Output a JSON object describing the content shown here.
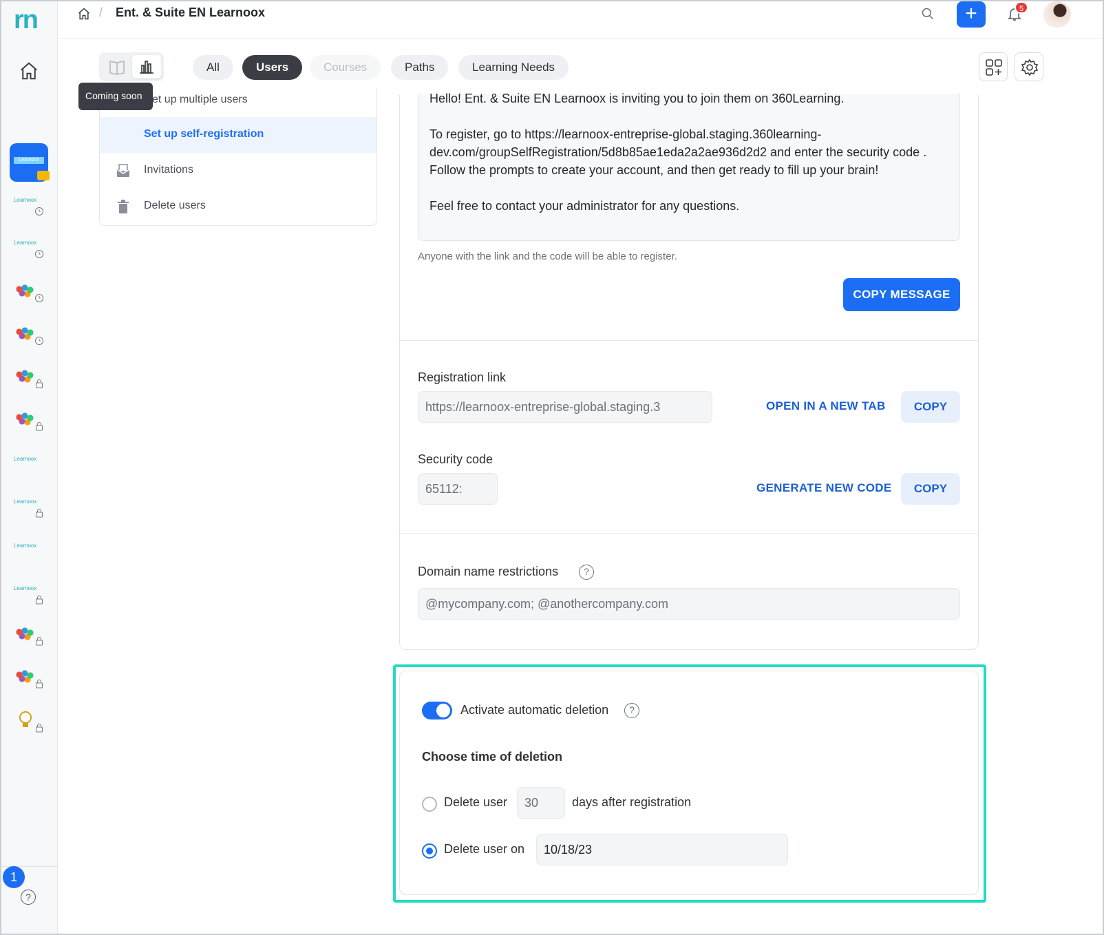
{
  "rail": {
    "logo": "rn",
    "active_mini": "Learnoox",
    "items": [
      {
        "label": "Learnoox"
      },
      {
        "label": "Learnoox"
      },
      {
        "label": "Learnoox"
      },
      {
        "label": "Learnoox"
      },
      {
        "label": "Learnoox"
      },
      {
        "label": "Learnoox"
      }
    ],
    "notification_count": "1",
    "help": "?"
  },
  "topbar": {
    "breadcrumb_separator": "/",
    "title": "Ent. & Suite EN Learnoox",
    "add_label": "+",
    "notifications_badge": "5"
  },
  "toolbar": {
    "tooltip": "Coming soon",
    "chips": [
      "All",
      "Users",
      "Courses",
      "Paths",
      "Learning Needs"
    ]
  },
  "submenu": {
    "items": [
      {
        "label": "Set up multiple users",
        "visible_label": "et up multiple users"
      },
      {
        "label": "Set up self-registration"
      },
      {
        "label": "Invitations"
      },
      {
        "label": "Delete users"
      }
    ]
  },
  "message": {
    "line1": "Hello! Ent. & Suite EN Learnoox is inviting you to join them on 360Learning.",
    "line2": "To register, go to https://learnoox-entreprise-global.staging.360learning-dev.com/groupSelfRegistration/5d8b85ae1eda2a2ae936d2d2 and enter the security code . Follow the prompts to create your account, and then get ready to fill up your brain!",
    "line3": "Feel free to contact your administrator for any questions.",
    "hint": "Anyone with the link and the code will be able to register.",
    "copy_button": "COPY MESSAGE"
  },
  "registration": {
    "label": "Registration link",
    "value": "https://learnoox-entreprise-global.staging.3",
    "open_tab": "OPEN IN A NEW TAB",
    "copy": "COPY"
  },
  "security": {
    "label": "Security code",
    "value": "65112:",
    "generate": "GENERATE NEW CODE",
    "copy": "COPY"
  },
  "domain": {
    "label": "Domain name restrictions",
    "placeholder": "@mycompany.com; @anothercompany.com"
  },
  "deletion": {
    "toggle_label": "Activate automatic deletion",
    "toggle_on": true,
    "choose_heading": "Choose time of deletion",
    "option1_prefix": "Delete user",
    "option1_days": "30",
    "option1_suffix": "days after registration",
    "option2_label": "Delete user on",
    "option2_date": "10/18/23",
    "selected_option": 2
  },
  "colors": {
    "accent": "#1b6ef3",
    "highlight": "#21dcc3"
  }
}
